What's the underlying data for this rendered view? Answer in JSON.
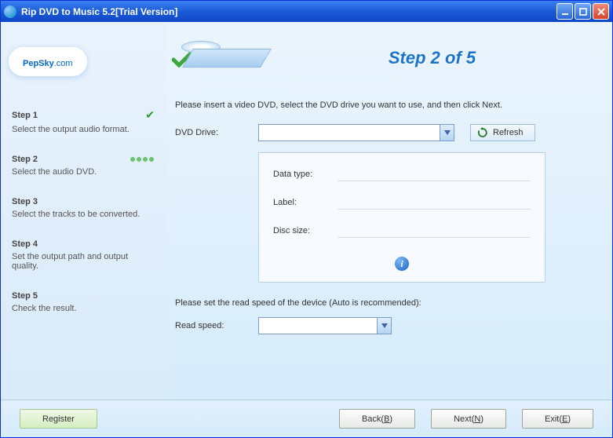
{
  "window": {
    "title": "Rip DVD to Music 5.2[Trial Version]"
  },
  "logo": {
    "brand": "PepSky",
    "domain": ".com"
  },
  "steps": [
    {
      "title": "Step 1",
      "desc": "Select the output audio format.",
      "state": "done"
    },
    {
      "title": "Step 2",
      "desc": "Select the audio DVD.",
      "state": "active"
    },
    {
      "title": "Step 3",
      "desc": "Select the tracks to be converted.",
      "state": ""
    },
    {
      "title": "Step 4",
      "desc": "Set the output path and output quality.",
      "state": ""
    },
    {
      "title": "Step 5",
      "desc": "Check the result.",
      "state": ""
    }
  ],
  "main": {
    "banner": "Step 2 of 5",
    "instruction": "Please insert a video DVD, select the DVD drive you want to use, and then click Next.",
    "dvd_drive_label": "DVD Drive:",
    "dvd_drive_value": "",
    "refresh_label": "Refresh",
    "info": {
      "data_type_label": "Data type:",
      "data_type_value": "",
      "label_label": "Label:",
      "label_value": "",
      "disc_size_label": "Disc size:",
      "disc_size_value": ""
    },
    "read_speed_instruction": "Please set the read speed of the device (Auto is recommended):",
    "read_speed_label": "Read speed:",
    "read_speed_value": ""
  },
  "buttons": {
    "register": "Register",
    "back": "Back(",
    "back_u": "B",
    "back_suf": ")",
    "next": "Next(",
    "next_u": "N",
    "next_suf": ")",
    "exit": "Exit(",
    "exit_u": "E",
    "exit_suf": ")"
  }
}
